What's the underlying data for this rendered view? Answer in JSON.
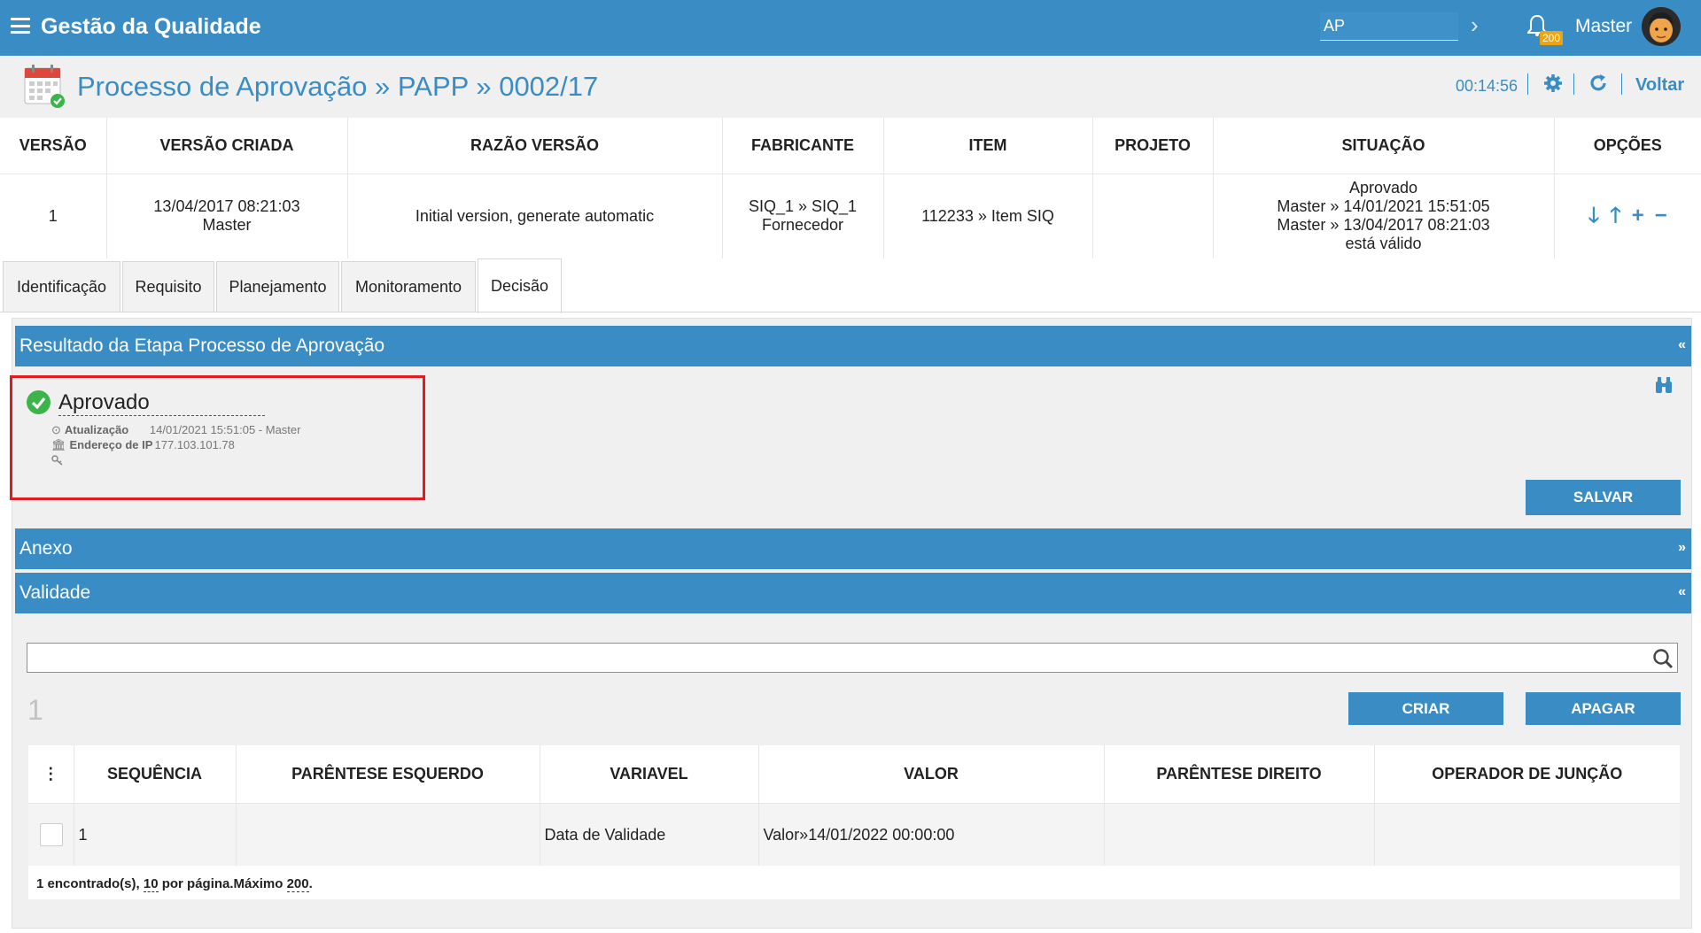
{
  "header": {
    "app_title": "Gestão da Qualidade",
    "search_value": "AP",
    "notification_count": "200",
    "user_name": "Master"
  },
  "page": {
    "title": "Processo de Aprovação » PAPP » 0002/17",
    "timer": "00:14:56",
    "back_label": "Voltar"
  },
  "version_table": {
    "columns": [
      "VERSÃO",
      "VERSÃO CRIADA",
      "RAZÃO VERSÃO",
      "FABRICANTE",
      "ITEM",
      "PROJETO",
      "SITUAÇÃO",
      "OPÇÕES"
    ],
    "row": {
      "versao": "1",
      "criada_data": "13/04/2017 08:21:03",
      "criada_por": "Master",
      "razao": "Initial version, generate automatic",
      "fabricante_1": "SIQ_1 » SIQ_1",
      "fabricante_2": "Fornecedor",
      "item": "112233 » Item SIQ",
      "projeto": "",
      "situacao_1": "Aprovado",
      "situacao_2": "Master » 14/01/2021 15:51:05",
      "situacao_3": "Master » 13/04/2017 08:21:03",
      "situacao_4": "está válido"
    }
  },
  "tabs": [
    "Identificação",
    "Requisito",
    "Planejamento",
    "Monitoramento",
    "Decisão"
  ],
  "sections": {
    "resultado": "Resultado da Etapa Processo de Aprovação",
    "anexo": "Anexo",
    "validade": "Validade"
  },
  "result": {
    "status": "Aprovado",
    "update_label": "Atualização",
    "update_value": "14/01/2021 15:51:05 - Master",
    "ip_label": "Endereço de IP",
    "ip_value": "177.103.101.78"
  },
  "buttons": {
    "salvar": "SALVAR",
    "criar": "CRIAR",
    "apagar": "APAGAR"
  },
  "validade": {
    "count": "1",
    "search_value": "",
    "columns": [
      "⋮",
      "SEQUÊNCIA",
      "PARÊNTESE ESQUERDO",
      "VARIAVEL",
      "VALOR",
      "PARÊNTESE DIREITO",
      "OPERADOR DE JUNÇÃO"
    ],
    "rows": [
      {
        "sequencia": "1",
        "parentese_esq": "",
        "variavel": "Data de Validade",
        "valor": "Valor»14/01/2022 00:00:00",
        "parentese_dir": "",
        "operador": ""
      }
    ],
    "footer": {
      "found": "1 encontrado(s), ",
      "per_page": "10",
      "per_page_text": " por página.Máximo ",
      "max": "200",
      "end": "."
    }
  },
  "colors": {
    "primary": "#3a8dc4",
    "success": "#3bb54a",
    "highlight": "#e21b23",
    "badge": "#f0a30a"
  }
}
